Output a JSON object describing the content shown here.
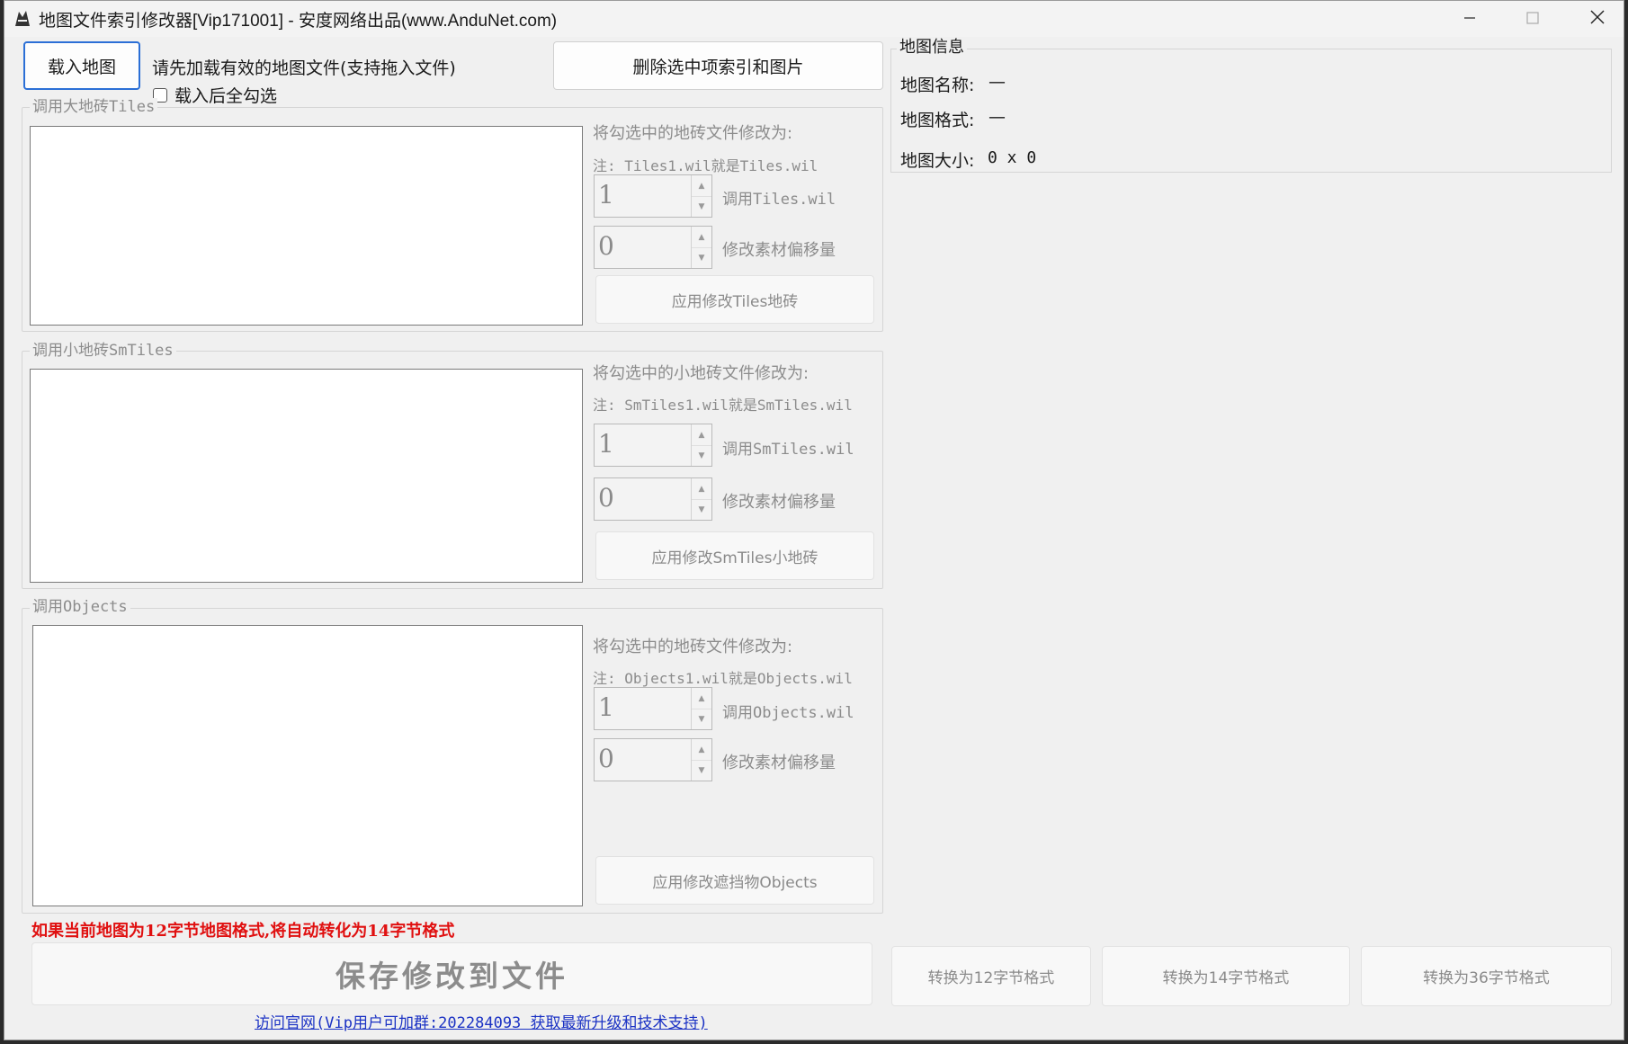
{
  "window": {
    "title": "地图文件索引修改器[Vip171001] - 安度网络出品(www.AnduNet.com)",
    "controls": {
      "minimize": "—",
      "maximize": "☐",
      "close": "✕"
    }
  },
  "top": {
    "load_button": "载入地图",
    "hint": "请先加载有效的地图文件(支持拖入文件)",
    "select_all_checkbox": {
      "label": "载入后全勾选",
      "checked": false
    },
    "delete_button": "删除选中项索引和图片"
  },
  "tiles": {
    "legend": "调用大地砖Tiles",
    "caption": "将勾选中的地砖文件修改为:",
    "note": "注: Tiles1.wil就是Tiles.wil",
    "index_value": "1",
    "index_label": "调用Tiles.wil",
    "offset_value": "0",
    "offset_label": "修改素材偏移量",
    "apply_button": "应用修改Tiles地砖"
  },
  "smtiles": {
    "legend": "调用小地砖SmTiles",
    "caption": "将勾选中的小地砖文件修改为:",
    "note": "注: SmTiles1.wil就是SmTiles.wil",
    "index_value": "1",
    "index_label": "调用SmTiles.wil",
    "offset_value": "0",
    "offset_label": "修改素材偏移量",
    "apply_button": "应用修改SmTiles小地砖"
  },
  "objects": {
    "legend": "调用Objects",
    "caption": "将勾选中的地砖文件修改为:",
    "note": "注: Objects1.wil就是Objects.wil",
    "index_value": "1",
    "index_label": "调用Objects.wil",
    "offset_value": "0",
    "offset_label": "修改素材偏移量",
    "apply_button": "应用修改遮挡物Objects"
  },
  "info": {
    "legend": "地图信息",
    "name_label": "地图名称:",
    "name_value": "—",
    "format_label": "地图格式:",
    "format_value": "—",
    "size_label": "地图大小:",
    "size_value": "0 x 0"
  },
  "bottom": {
    "warning": "如果当前地图为12字节地图格式,将自动转化为14字节格式",
    "save_button": "保存修改到文件",
    "convert12_button": "转换为12字节格式",
    "convert14_button": "转换为14字节格式",
    "convert36_button": "转换为36字节格式",
    "website_link": "访问官网(Vip用户可加群:202284093 获取最新升级和技术支持)"
  },
  "colors": {
    "accent": "#2b6fd6",
    "warning": "#e01010",
    "link": "#1b32c4",
    "disabled_text": "#8a8a8a"
  },
  "icons": {
    "spin_up": "▲",
    "spin_down": "▼"
  }
}
